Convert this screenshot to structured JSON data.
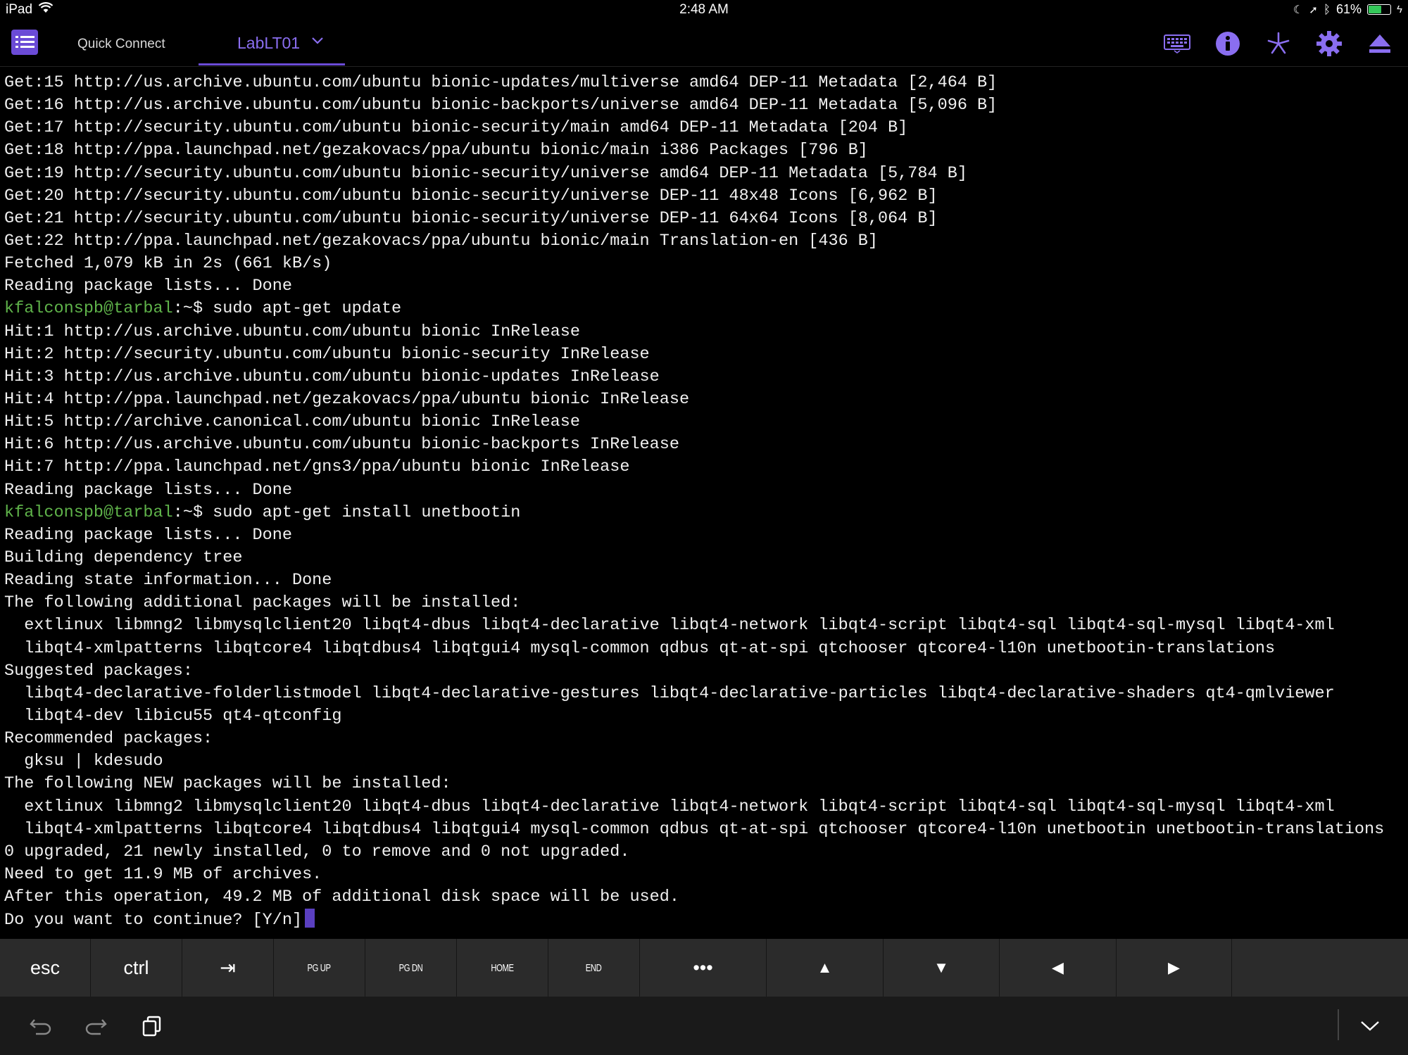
{
  "status_bar": {
    "device": "iPad",
    "time": "2:48 AM",
    "battery": "61%",
    "battery_level": 0.61
  },
  "toolbar": {
    "quick_connect": "Quick Connect",
    "active_tab": "LabLT01",
    "icons": [
      "menu-icon",
      "keyboard-icon",
      "info-icon",
      "asterisk-icon",
      "gear-icon",
      "eject-icon"
    ]
  },
  "colors": {
    "accent": "#6b4bd6",
    "prompt_user": "#5fb34a",
    "prompt_path": "#5f7fe0",
    "background": "#000000"
  },
  "terminal": {
    "prompt_user": "kfalconspb@tarbal",
    "prompt_path": ":~",
    "lines": [
      {
        "t": "Get:15 http://us.archive.ubuntu.com/ubuntu bionic-updates/multiverse amd64 DEP-11 Metadata [2,464 B]"
      },
      {
        "t": "Get:16 http://us.archive.ubuntu.com/ubuntu bionic-backports/universe amd64 DEP-11 Metadata [5,096 B]"
      },
      {
        "t": "Get:17 http://security.ubuntu.com/ubuntu bionic-security/main amd64 DEP-11 Metadata [204 B]"
      },
      {
        "t": "Get:18 http://ppa.launchpad.net/gezakovacs/ppa/ubuntu bionic/main i386 Packages [796 B]"
      },
      {
        "t": "Get:19 http://security.ubuntu.com/ubuntu bionic-security/universe amd64 DEP-11 Metadata [5,784 B]"
      },
      {
        "t": "Get:20 http://security.ubuntu.com/ubuntu bionic-security/universe DEP-11 48x48 Icons [6,962 B]"
      },
      {
        "t": "Get:21 http://security.ubuntu.com/ubuntu bionic-security/universe DEP-11 64x64 Icons [8,064 B]"
      },
      {
        "t": "Get:22 http://ppa.launchpad.net/gezakovacs/ppa/ubuntu bionic/main Translation-en [436 B]"
      },
      {
        "t": "Fetched 1,079 kB in 2s (661 kB/s)"
      },
      {
        "t": "Reading package lists... Done"
      },
      {
        "prompt": true,
        "t": "$ sudo apt-get update"
      },
      {
        "t": "Hit:1 http://us.archive.ubuntu.com/ubuntu bionic InRelease"
      },
      {
        "t": "Hit:2 http://security.ubuntu.com/ubuntu bionic-security InRelease"
      },
      {
        "t": "Hit:3 http://us.archive.ubuntu.com/ubuntu bionic-updates InRelease"
      },
      {
        "t": "Hit:4 http://ppa.launchpad.net/gezakovacs/ppa/ubuntu bionic InRelease"
      },
      {
        "t": "Hit:5 http://archive.canonical.com/ubuntu bionic InRelease"
      },
      {
        "t": "Hit:6 http://us.archive.ubuntu.com/ubuntu bionic-backports InRelease"
      },
      {
        "t": "Hit:7 http://ppa.launchpad.net/gns3/ppa/ubuntu bionic InRelease"
      },
      {
        "t": "Reading package lists... Done"
      },
      {
        "prompt": true,
        "t": "$ sudo apt-get install unetbootin"
      },
      {
        "t": "Reading package lists... Done"
      },
      {
        "t": "Building dependency tree"
      },
      {
        "t": "Reading state information... Done"
      },
      {
        "t": "The following additional packages will be installed:"
      },
      {
        "t": "  extlinux libmng2 libmysqlclient20 libqt4-dbus libqt4-declarative libqt4-network libqt4-script libqt4-sql libqt4-sql-mysql libqt4-xml"
      },
      {
        "t": "  libqt4-xmlpatterns libqtcore4 libqtdbus4 libqtgui4 mysql-common qdbus qt-at-spi qtchooser qtcore4-l10n unetbootin-translations"
      },
      {
        "t": "Suggested packages:"
      },
      {
        "t": "  libqt4-declarative-folderlistmodel libqt4-declarative-gestures libqt4-declarative-particles libqt4-declarative-shaders qt4-qmlviewer"
      },
      {
        "t": "  libqt4-dev libicu55 qt4-qtconfig"
      },
      {
        "t": "Recommended packages:"
      },
      {
        "t": "  gksu | kdesudo"
      },
      {
        "t": "The following NEW packages will be installed:"
      },
      {
        "t": "  extlinux libmng2 libmysqlclient20 libqt4-dbus libqt4-declarative libqt4-network libqt4-script libqt4-sql libqt4-sql-mysql libqt4-xml"
      },
      {
        "t": "  libqt4-xmlpatterns libqtcore4 libqtdbus4 libqtgui4 mysql-common qdbus qt-at-spi qtchooser qtcore4-l10n unetbootin unetbootin-translations"
      },
      {
        "t": "0 upgraded, 21 newly installed, 0 to remove and 0 not upgraded."
      },
      {
        "t": "Need to get 11.9 MB of archives."
      },
      {
        "t": "After this operation, 49.2 MB of additional disk space will be used."
      },
      {
        "t": "Do you want to continue? [Y/n]",
        "cursor": true
      }
    ]
  },
  "keybar": {
    "keys": [
      {
        "label": "esc",
        "style": "big",
        "name": "esc-key",
        "w": 129
      },
      {
        "label": "ctrl",
        "style": "big",
        "name": "ctrl-key",
        "w": 130
      },
      {
        "label": "⇥",
        "style": "big",
        "name": "tab-key",
        "w": 130
      },
      {
        "label": "PG UP",
        "style": "small",
        "name": "page-up-key",
        "w": 130
      },
      {
        "label": "PG DN",
        "style": "small",
        "name": "page-down-key",
        "w": 130
      },
      {
        "label": "HOME",
        "style": "small",
        "name": "home-key",
        "w": 130
      },
      {
        "label": "END",
        "style": "small",
        "name": "end-key",
        "w": 130
      },
      {
        "label": "•••",
        "style": "big",
        "name": "more-keys-button",
        "w": 180
      },
      {
        "label": "▲",
        "style": "big",
        "name": "arrow-up-key",
        "w": 166
      },
      {
        "label": "▼",
        "style": "big",
        "name": "arrow-down-key",
        "w": 165
      },
      {
        "label": "◀",
        "style": "big",
        "name": "arrow-left-key",
        "w": 166
      },
      {
        "label": "▶",
        "style": "big",
        "name": "arrow-right-key",
        "w": 164
      }
    ]
  }
}
